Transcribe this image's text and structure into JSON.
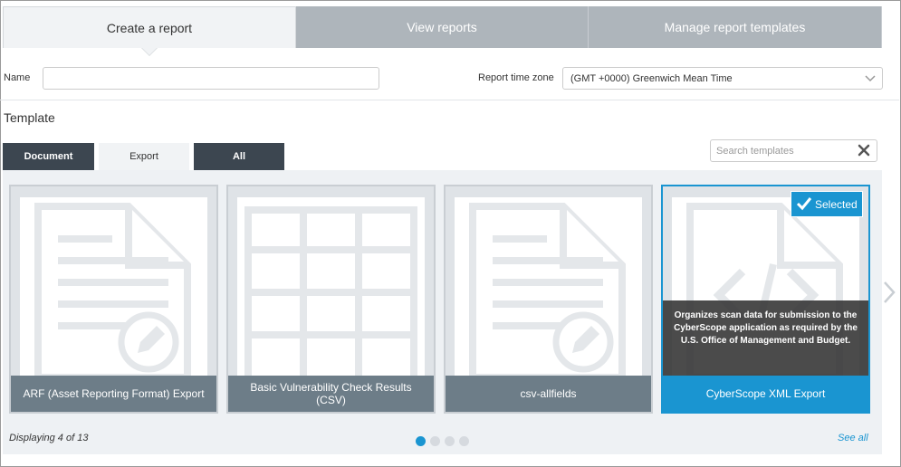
{
  "tabs": [
    {
      "label": "Create a report",
      "active": true
    },
    {
      "label": "View reports",
      "active": false
    },
    {
      "label": "Manage report templates",
      "active": false
    }
  ],
  "form": {
    "name_label": "Name",
    "name_value": "",
    "timezone_label": "Report time zone",
    "timezone_value": "(GMT +0000) Greenwich Mean Time"
  },
  "template": {
    "title": "Template",
    "tabs": [
      {
        "label": "Document",
        "active": false
      },
      {
        "label": "Export",
        "active": true
      },
      {
        "label": "All",
        "active": false
      }
    ],
    "search_placeholder": "Search templates",
    "cards": [
      {
        "name": "ARF (Asset Reporting Format) Export",
        "icon": "document-edit-icon",
        "selected": false
      },
      {
        "name": "Basic Vulnerability Check Results (CSV)",
        "icon": "spreadsheet-grid-icon",
        "selected": false
      },
      {
        "name": "csv-allfields",
        "icon": "document-edit-icon",
        "selected": false
      },
      {
        "name": "CyberScope XML Export",
        "icon": "xml-code-document-icon",
        "selected": true,
        "selected_badge": "Selected",
        "description": "Organizes scan data for submission to the CyberScope application as required by the U.S. Office of Management and Budget."
      }
    ],
    "displaying": "Displaying 4 of 13",
    "pages": 4,
    "current_page": 1,
    "see_all": "See all"
  },
  "colors": {
    "accent": "#1a95d1",
    "dark_tab": "#3c4650",
    "inactive_tab": "#aeb5bb",
    "caption": "#6d7d88"
  }
}
